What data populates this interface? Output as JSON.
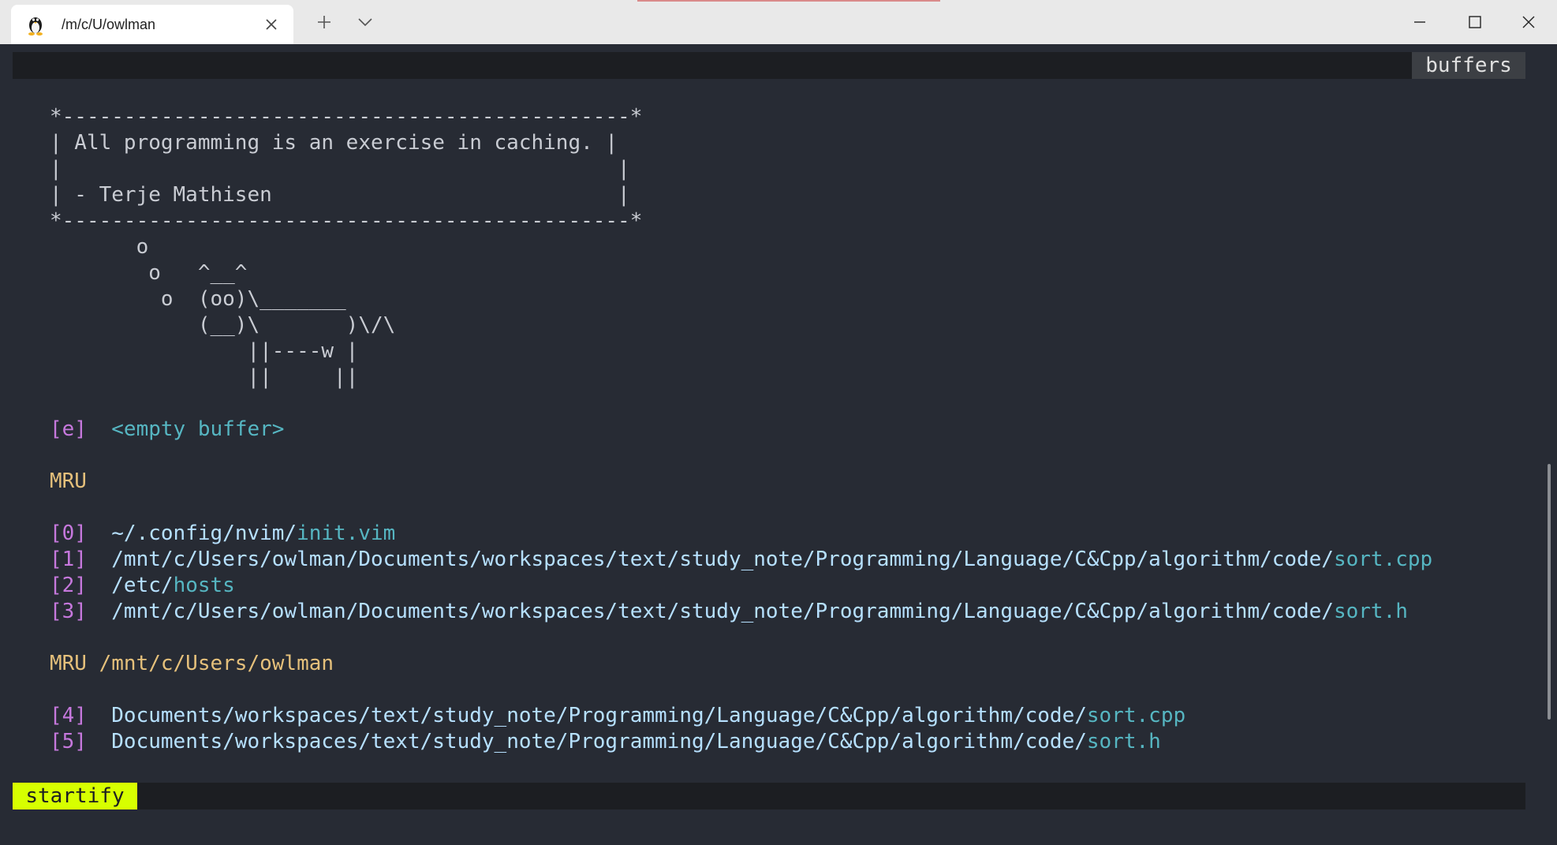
{
  "window": {
    "tab_title": "/m/c/U/owlman",
    "tab_icon": "tux-penguin-icon"
  },
  "terminal": {
    "tabline_label": "buffers",
    "quote_box": [
      "*----------------------------------------------*",
      "| All programming is an exercise in caching. |",
      "|                                             |",
      "| - Terje Mathisen                            |",
      "*----------------------------------------------*"
    ],
    "cow": [
      "       o",
      "        o   ^__^",
      "         o  (oo)\\_______",
      "            (__)\\       )\\/\\",
      "                ||----w |",
      "                ||     ||"
    ],
    "empty_buffer": {
      "key": "[e]",
      "label": "<empty buffer>"
    },
    "mru_header": "MRU",
    "mru": [
      {
        "key": "[0]",
        "path": "~/.config/nvim/",
        "file": "init.vim"
      },
      {
        "key": "[1]",
        "path": "/mnt/c/Users/owlman/Documents/workspaces/text/study_note/Programming/Language/C&Cpp/algorithm/code/",
        "file": "sort.cpp"
      },
      {
        "key": "[2]",
        "path": "/etc/",
        "file": "hosts"
      },
      {
        "key": "[3]",
        "path": "/mnt/c/Users/owlman/Documents/workspaces/text/study_note/Programming/Language/C&Cpp/algorithm/code/",
        "file": "sort.h"
      }
    ],
    "mru_dir_header": "MRU /mnt/c/Users/owlman",
    "mru_dir": [
      {
        "key": "[4]",
        "path": "Documents/workspaces/text/study_note/Programming/Language/C&Cpp/algorithm/code/",
        "file": "sort.cpp"
      },
      {
        "key": "[5]",
        "path": "Documents/workspaces/text/study_note/Programming/Language/C&Cpp/algorithm/code/",
        "file": "sort.h"
      }
    ],
    "statusline_mode": "startify"
  },
  "colors": {
    "background": "#272b34",
    "index": "#c678dd",
    "path": "#b6e0ff",
    "filename": "#56b6c2",
    "header": "#e5c07b",
    "mode_bg": "#d7ff00"
  }
}
